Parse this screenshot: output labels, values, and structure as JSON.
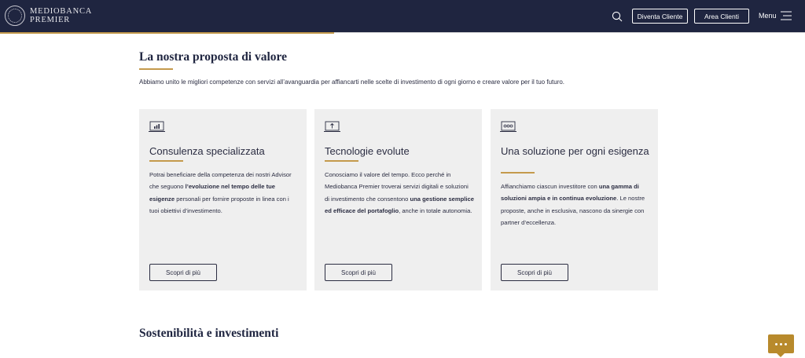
{
  "header": {
    "logo_line1": "MEDIOBANCA",
    "logo_line2": "PREMIER",
    "diventa_cliente": "Diventa Cliente",
    "area_clienti": "Area Clienti",
    "menu": "Menu",
    "background_color": "#1f2540",
    "accent_color": "#c49a4c"
  },
  "section1": {
    "title": "La nostra proposta di valore",
    "intro": "Abbiamo unito le migliori competenze con servizi all’avanguardia per affiancarti nelle scelte di investimento di ogni giorno e creare valore per il tuo futuro."
  },
  "cards": [
    {
      "icon": "chart-laptop-icon",
      "title": "Consulenza specializzata",
      "text_parts": [
        "Potrai beneficiare della competenza dei nostri Advisor che seguono ",
        "l’evoluzione nel tempo delle tue esigenze",
        " personali per fornire proposte in linea con i tuoi obiettivi d’investimento."
      ],
      "button": "Scopri di più"
    },
    {
      "icon": "upload-laptop-icon",
      "title": "Tecnologie evolute",
      "text_parts": [
        "Conosciamo il valore del tempo. Ecco perché in Mediobanca Premier troverai servizi digitali e soluzioni di investimento che consentono ",
        "una gestione semplice ed efficace del portafoglio",
        ", anche in totale autonomia."
      ],
      "button": "Scopri di più"
    },
    {
      "icon": "dashboard-laptop-icon",
      "title": "Una soluzione per ogni esigenza",
      "text_parts": [
        "Affianchiamo ciascun investitore con ",
        "una gamma di soluzioni ampia e in continua evoluzione",
        ". Le nostre proposte, anche in esclusiva, nascono da sinergie con partner d’eccellenza."
      ],
      "button": "Scopri di più"
    }
  ],
  "section2": {
    "title": "Sostenibilità e investimenti"
  },
  "chat": {
    "icon": "chat-bubble-icon",
    "color": "#b88a2c"
  }
}
